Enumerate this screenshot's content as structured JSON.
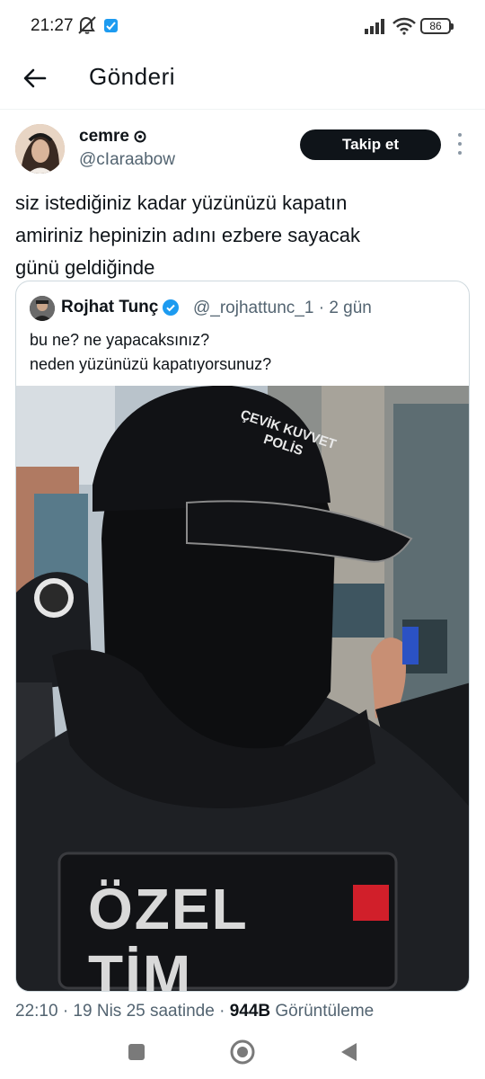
{
  "status_bar": {
    "time": "21:27",
    "battery": "86",
    "icons": [
      "mute-icon",
      "twitter-icon",
      "signal-icon",
      "wifi-icon",
      "battery-icon"
    ]
  },
  "header": {
    "title": "Gönderi",
    "back_icon": "arrow-left-icon"
  },
  "tweet": {
    "author_name": "cemre",
    "author_handle": "@cIaraabow",
    "follow_label": "Takip et",
    "text": "siz istediğiniz kadar yüzünüzü kapatın\namiriniz hepinizin adını ezbere sayacak\ngünü geldiğinde",
    "quote": {
      "author_name": "Rojhat Tunç",
      "meta": "@_rojhattunc_1 · 2 gün",
      "text": "bu ne? ne yapacaksınız?\nneden yüzünüzü kapatıyorsunuz?",
      "media": {
        "cap_text": "ÇEVİK KUVVET POLİS",
        "vest_text": "ÖZEL TİM"
      }
    },
    "footer": {
      "time": "22:10 · 19 Nis 25 saatinde · ",
      "views_count": "944B",
      "views_label": " Görüntüleme"
    }
  },
  "colors": {
    "accent": "#1d9bf0",
    "text_primary": "#0f1419",
    "text_secondary": "#536471",
    "border": "#cfd9de"
  }
}
